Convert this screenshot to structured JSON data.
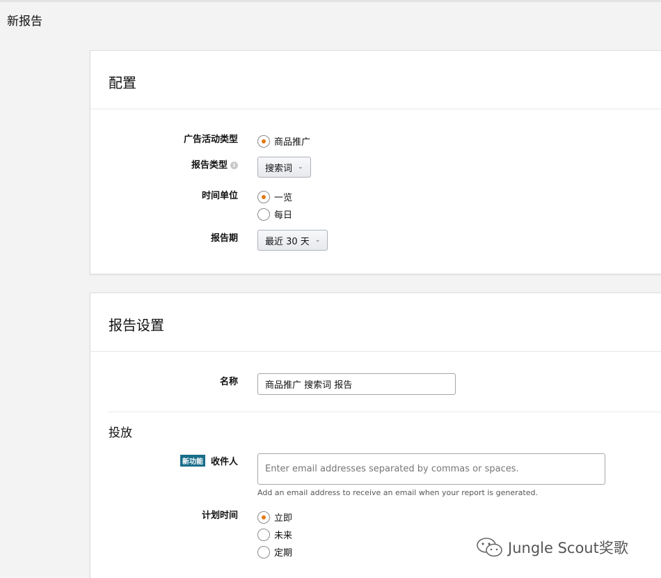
{
  "page": {
    "title": "新报告"
  },
  "config": {
    "heading": "配置",
    "campaign_type": {
      "label": "广告活动类型",
      "option": "商品推广"
    },
    "report_type": {
      "label": "报告类型",
      "value": "搜索词"
    },
    "time_unit": {
      "label": "时间单位",
      "options": [
        "一览",
        "每日"
      ],
      "selected": "一览"
    },
    "period": {
      "label": "报告期",
      "value": "最近 30 天"
    }
  },
  "settings": {
    "heading": "报告设置",
    "name": {
      "label": "名称",
      "value": "商品推广 搜索词 报告"
    },
    "delivery": {
      "title": "投放",
      "new_badge": "新功能",
      "recipients": {
        "label": "收件人",
        "placeholder": "Enter email addresses separated by commas or spaces.",
        "hint": "Add an email address to receive an email when your report is generated."
      },
      "schedule": {
        "label": "计划时间",
        "options": [
          "立即",
          "未来",
          "定期"
        ],
        "selected": "立即"
      }
    }
  },
  "watermark": {
    "text": "Jungle Scout奖歌"
  },
  "colors": {
    "accent": "#e47911",
    "badge": "#1a6e8a"
  }
}
